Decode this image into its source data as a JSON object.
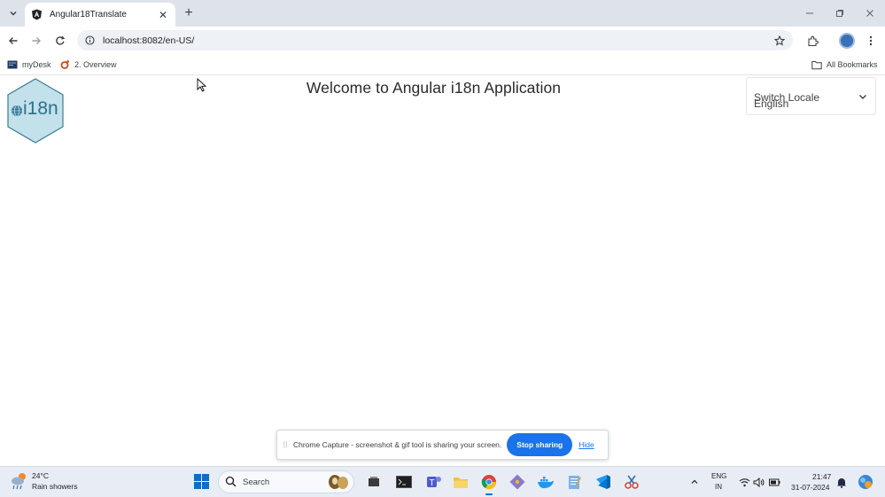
{
  "browser": {
    "tab_title": "Angular18Translate",
    "url": "localhost:8082/en-US/",
    "bookmarks": [
      {
        "label": "myDesk",
        "icon": "mydesk-icon"
      },
      {
        "label": "2. Overview",
        "icon": "overview-icon"
      }
    ],
    "all_bookmarks_label": "All Bookmarks"
  },
  "page": {
    "logo_text": "i18n",
    "title": "Welcome to Angular i18n Application",
    "locale": {
      "label": "Switch Locale",
      "value": "English"
    }
  },
  "share_bar": {
    "message": "Chrome Capture - screenshot & gif tool is sharing your screen.",
    "stop_label": "Stop sharing",
    "hide_label": "Hide"
  },
  "taskbar": {
    "weather_temp": "24°C",
    "weather_desc": "Rain showers",
    "search_placeholder": "Search",
    "lang_line1": "ENG",
    "lang_line2": "IN",
    "time": "21:47",
    "date": "31-07-2024"
  },
  "colors": {
    "accent": "#1a73e8",
    "tabstrip": "#dee3ea",
    "logo_fill": "#c3e1ea",
    "logo_stroke": "#3a7d95"
  }
}
